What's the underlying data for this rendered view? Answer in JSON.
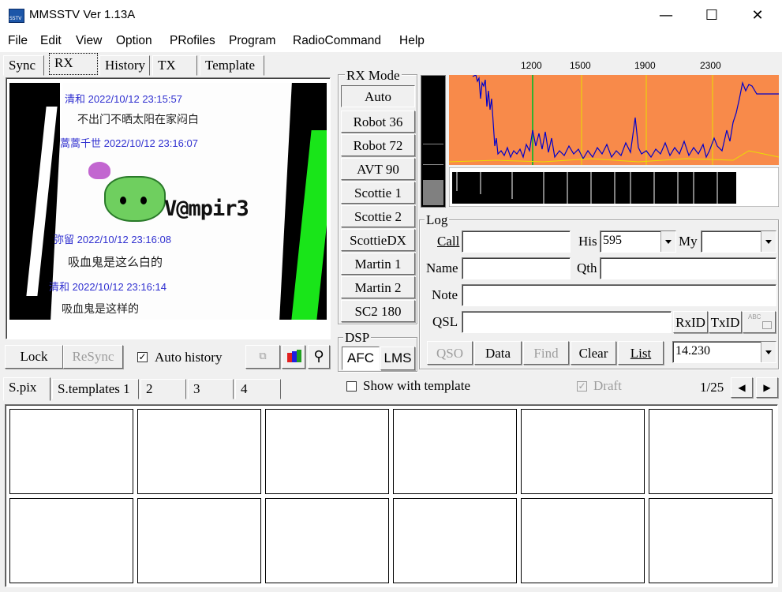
{
  "window": {
    "title": "MMSSTV Ver 1.13A",
    "minimize": "—",
    "maximize": "☐",
    "close": "✕"
  },
  "menu": [
    "File",
    "Edit",
    "View",
    "Option",
    "PRofiles",
    "Program",
    "RadioCommand",
    "Help"
  ],
  "top_tabs": [
    "Sync",
    "RX",
    "History",
    "TX",
    "Template"
  ],
  "rx_image": {
    "lines": [
      {
        "name": "清和",
        "time": "2022/10/12 23:15:57",
        "msg": "不出门不晒太阳在家闷白"
      },
      {
        "name": "蒿蒿千世",
        "time": "2022/10/12 23:16:07",
        "msg": ""
      },
      {
        "name": "弥留",
        "time": "2022/10/12 23:16:08",
        "msg": "吸血鬼是这么白的"
      },
      {
        "name": "清和",
        "time": "2022/10/12 23:16:14",
        "msg": "吸血鬼是这样的"
      }
    ],
    "handle": "V@mpir3"
  },
  "rx_controls": {
    "lock": "Lock",
    "resync": "ReSync",
    "auto_history": "Auto history",
    "auto_history_checked": true
  },
  "rx_mode": {
    "title": "RX Mode",
    "modes": [
      "Auto",
      "Robot 36",
      "Robot 72",
      "AVT 90",
      "Scottie 1",
      "Scottie 2",
      "ScottieDX",
      "Martin 1",
      "Martin 2",
      "SC2 180"
    ],
    "selected": "Auto"
  },
  "dsp": {
    "title": "DSP",
    "afc": "AFC",
    "lms": "LMS"
  },
  "spectrum": {
    "freq_labels": [
      "1200",
      "1500",
      "1900",
      "2300"
    ],
    "bg_color": "#f88a4a",
    "trace_color": "#0000cc"
  },
  "log": {
    "title": "Log",
    "call_label": "Call",
    "call_value": "",
    "his_label": "His",
    "his_value": "595",
    "my_label": "My",
    "my_value": "",
    "name_label": "Name",
    "name_value": "",
    "qth_label": "Qth",
    "qth_value": "",
    "note_label": "Note",
    "note_value": "",
    "qsl_label": "QSL",
    "qsl_value": "",
    "rxid": "RxID",
    "txid": "TxID",
    "abc": "ABC",
    "qso": "QSO",
    "data": "Data",
    "find": "Find",
    "clear": "Clear",
    "list": "List",
    "freq": "14.230"
  },
  "bottom_tabs": [
    "S.pix",
    "S.templates 1",
    "2",
    "3",
    "4"
  ],
  "show_with_template": "Show with template",
  "draft": "Draft",
  "page": "1/25"
}
